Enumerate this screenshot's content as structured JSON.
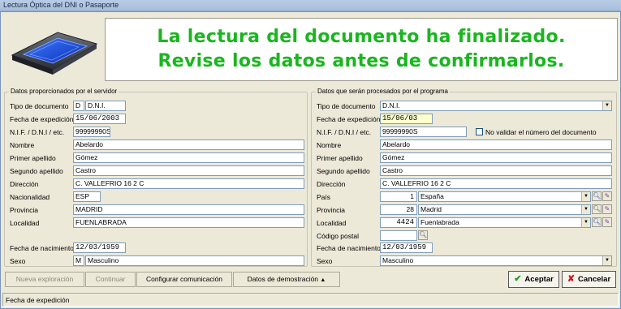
{
  "window": {
    "title": "Lectura Óptica del DNI o Pasaporte"
  },
  "banner": {
    "line1": "La lectura del documento ha finalizado.",
    "line2": "Revise los datos antes de confirmarlos."
  },
  "left": {
    "legend": "Datos proporcionados por el servidor",
    "labels": {
      "tipo_documento": "Tipo de documento",
      "fecha_expedicion": "Fecha de expedición",
      "nif": "N.I.F. / D.N.I / etc.",
      "nombre": "Nombre",
      "primer_apellido": "Primer apellido",
      "segundo_apellido": "Segundo apellido",
      "direccion": "Dirección",
      "nacionalidad": "Nacionalidad",
      "provincia": "Provincia",
      "localidad": "Localidad",
      "fecha_nacimiento": "Fecha de nacimiento",
      "sexo": "Sexo"
    },
    "values": {
      "tipo_documento_code": "D",
      "tipo_documento": "D.N.I.",
      "fecha_expedicion": "15/06/2003",
      "nif": "99999990S",
      "nombre": "Abelardo",
      "primer_apellido": "Gómez",
      "segundo_apellido": "Castro",
      "direccion": "C. VALLEFRIO 16 2 C",
      "nacionalidad": "ESP",
      "provincia": "MADRID",
      "localidad": "FUENLABRADA",
      "fecha_nacimiento": "12/03/1959",
      "sexo_code": "M",
      "sexo": "Masculino"
    }
  },
  "right": {
    "legend": "Datos que serán procesados por el programa",
    "labels": {
      "tipo_documento": "Tipo de documento",
      "fecha_expedicion": "Fecha de expedición",
      "nif": "N.I.F. / D.N.I / etc.",
      "no_validar": "No validar el número del documento",
      "nombre": "Nombre",
      "primer_apellido": "Primer apellido",
      "segundo_apellido": "Segundo apellido",
      "direccion": "Dirección",
      "pais": "País",
      "provincia": "Provincia",
      "localidad": "Localidad",
      "codigo_postal": "Código postal",
      "fecha_nacimiento": "Fecha de nacimiento",
      "sexo": "Sexo"
    },
    "values": {
      "tipo_documento": "D.N.I.",
      "fecha_expedicion": "15/06/03",
      "nif": "99999990S",
      "no_validar_checked": false,
      "nombre": "Abelardo",
      "primer_apellido": "Gómez",
      "segundo_apellido": "Castro",
      "direccion": "C. VALLEFRIO 16 2 C",
      "pais_code": "1",
      "pais": "España",
      "provincia_code": "28",
      "provincia": "Madrid",
      "localidad_code": "4424",
      "localidad": "Fuenlabrada",
      "codigo_postal": "",
      "fecha_nacimiento": "12/03/1959",
      "sexo": "Masculino"
    }
  },
  "buttons": {
    "nueva_exploracion": "Nueva exploración",
    "continuar": "Continuar",
    "configurar": "Configurar comunicación",
    "datos_demo": "Datos de demostración",
    "aceptar": "Aceptar",
    "cancelar": "Cancelar"
  },
  "status": {
    "text": "Fecha de expedición"
  },
  "colors": {
    "banner_text": "#1bb520",
    "highlight_field": "#ffffcc"
  }
}
